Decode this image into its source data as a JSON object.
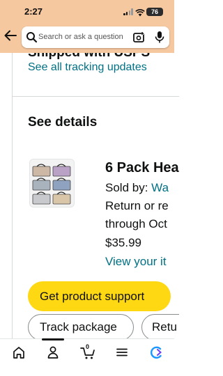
{
  "status_bar": {
    "time": "2:27",
    "battery": "76"
  },
  "search": {
    "placeholder": "Search or ask a question"
  },
  "tracking": {
    "cut_heading": "Shipped with USPS",
    "link_label": "See all tracking updates"
  },
  "details": {
    "heading": "See details",
    "product": {
      "title": "6 Pack Hea",
      "sold_by_prefix": "Sold by: ",
      "sold_by_seller": "Wa",
      "return_line": "Return or re",
      "through_line": "through Oct",
      "price": "$35.99",
      "view_link": "View your it"
    }
  },
  "buttons": {
    "support": "Get product support",
    "track": "Track package",
    "return": "Retu"
  },
  "bottom_nav": {
    "cart_count": "0"
  },
  "colors": {
    "header_bg": "#f6c89f",
    "link": "#007185",
    "primary_button": "#ffd814"
  },
  "icons": [
    "back-arrow-icon",
    "search-icon",
    "camera-icon",
    "mic-icon",
    "home-icon",
    "person-icon",
    "cart-icon",
    "menu-icon",
    "ai-assistant-icon"
  ]
}
